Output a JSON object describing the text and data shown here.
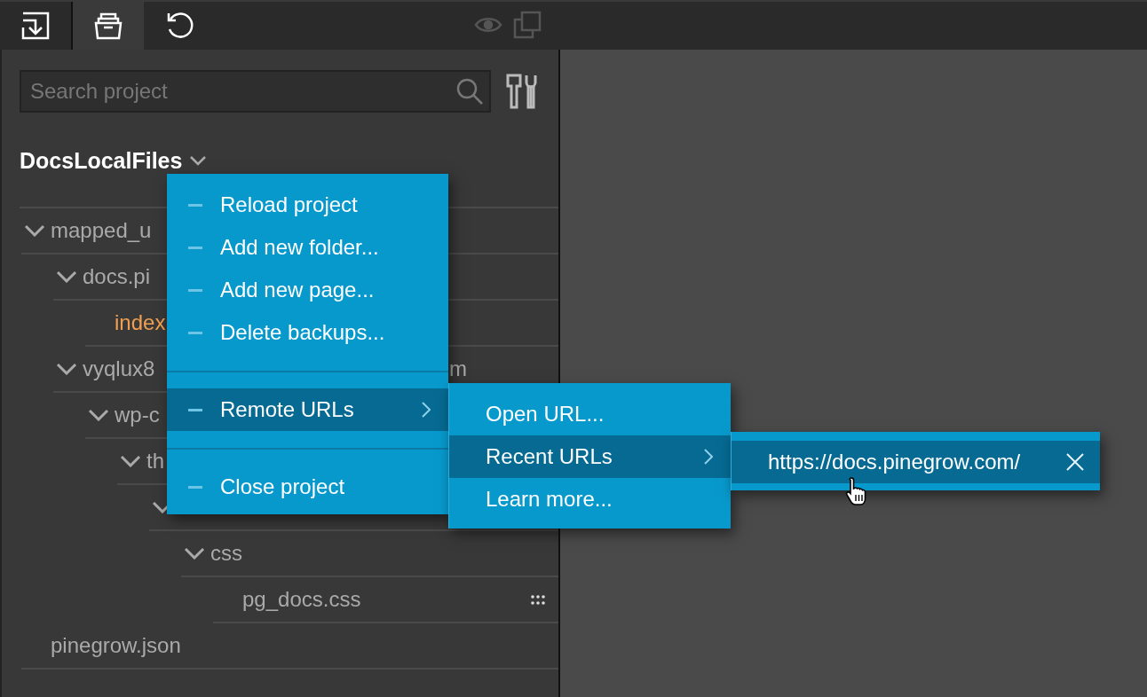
{
  "toolbar": {
    "tabs": [
      {
        "kind": "import",
        "selected": false
      },
      {
        "kind": "archive",
        "selected": true
      },
      {
        "kind": "undo",
        "selected": false
      }
    ],
    "view_buttons": [
      {
        "kind": "eye",
        "disabled": true
      },
      {
        "kind": "copy",
        "disabled": true
      }
    ]
  },
  "search": {
    "placeholder": "Search project"
  },
  "project": {
    "title": "DocsLocalFiles",
    "expanded": true
  },
  "tree": [
    {
      "kind": "folder",
      "label": "mapped_u",
      "expanded": true,
      "children": [
        {
          "kind": "folder",
          "label": "docs.pi",
          "expanded": true,
          "children": [
            {
              "kind": "file",
              "label": "index",
              "open": true
            }
          ]
        },
        {
          "kind": "folder",
          "label": "vyqlux8",
          "label_tail": "m",
          "expanded": true,
          "children": [
            {
              "kind": "folder",
              "label": "wp-c",
              "expanded": true,
              "children": [
                {
                  "kind": "folder",
                  "label": "th",
                  "expanded": true,
                  "children": [
                    {
                      "kind": "folder",
                      "expanded": true,
                      "children": [
                        {
                          "kind": "folder",
                          "label": "css",
                          "expanded": true,
                          "children": [
                            {
                              "kind": "file",
                              "label": "pg_docs.css",
                              "open": false,
                              "handle": true
                            }
                          ]
                        }
                      ]
                    }
                  ]
                }
              ]
            }
          ]
        }
      ]
    },
    {
      "kind": "file",
      "label": "pinegrow.json",
      "open": false
    }
  ],
  "context_menu": {
    "items": [
      {
        "kind": "item",
        "label": "Reload project",
        "selected": false
      },
      {
        "kind": "item",
        "label": "Add new folder...",
        "selected": false
      },
      {
        "kind": "item",
        "label": "Add new page...",
        "selected": false
      },
      {
        "kind": "item",
        "label": "Delete backups...",
        "selected": false
      },
      {
        "kind": "separator"
      },
      {
        "kind": "submenu",
        "label": "Remote URLs",
        "selected": true
      },
      {
        "kind": "separator"
      },
      {
        "kind": "item",
        "label": "Close project",
        "selected": false
      }
    ]
  },
  "remote_urls_menu": {
    "items": [
      {
        "kind": "item",
        "label": "Open URL...",
        "selected": false
      },
      {
        "kind": "submenu",
        "label": "Recent URLs",
        "selected": true
      },
      {
        "kind": "item",
        "label": "Learn more...",
        "selected": false
      }
    ]
  },
  "recent_urls_menu": {
    "items": [
      {
        "kind": "url",
        "label": "https://docs.pinegrow.com/",
        "selected": true,
        "removable": true
      }
    ]
  }
}
